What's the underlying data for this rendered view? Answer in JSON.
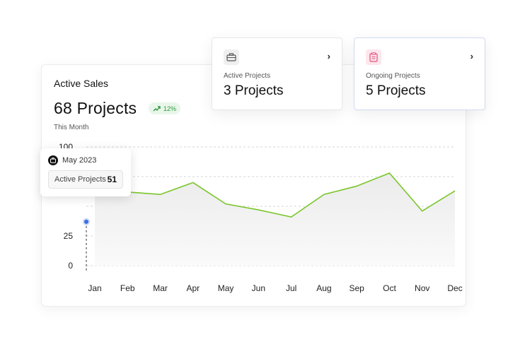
{
  "active_sales": {
    "title": "Active Sales",
    "value": "68 Projects",
    "trend": "12%",
    "period": "This Month",
    "trend_color": "#2e9a3b",
    "line_color": "#7ac62a"
  },
  "stat_cards": [
    {
      "label": "Active Projects",
      "value": "3 Projects",
      "icon": "briefcase-icon"
    },
    {
      "label": "Ongoing Projects",
      "value": "5 Projects",
      "icon": "clipboard-icon"
    }
  ],
  "tooltip": {
    "date": "May 2023",
    "label": "Active Projects",
    "value": "51",
    "icon": "briefcase-icon"
  },
  "chart_data": {
    "type": "area",
    "categories": [
      "Jan",
      "Feb",
      "Mar",
      "Apr",
      "May",
      "Jun",
      "Jul",
      "Aug",
      "Sep",
      "Oct",
      "Nov",
      "Dec"
    ],
    "values": [
      69,
      62,
      60,
      70,
      52,
      47,
      41,
      60,
      67,
      78,
      46,
      63
    ],
    "y_ticks": [
      "0",
      "25",
      "100"
    ],
    "ylim": [
      0,
      100
    ],
    "grid": true,
    "highlight": {
      "category": "Jan",
      "value": 37
    }
  }
}
